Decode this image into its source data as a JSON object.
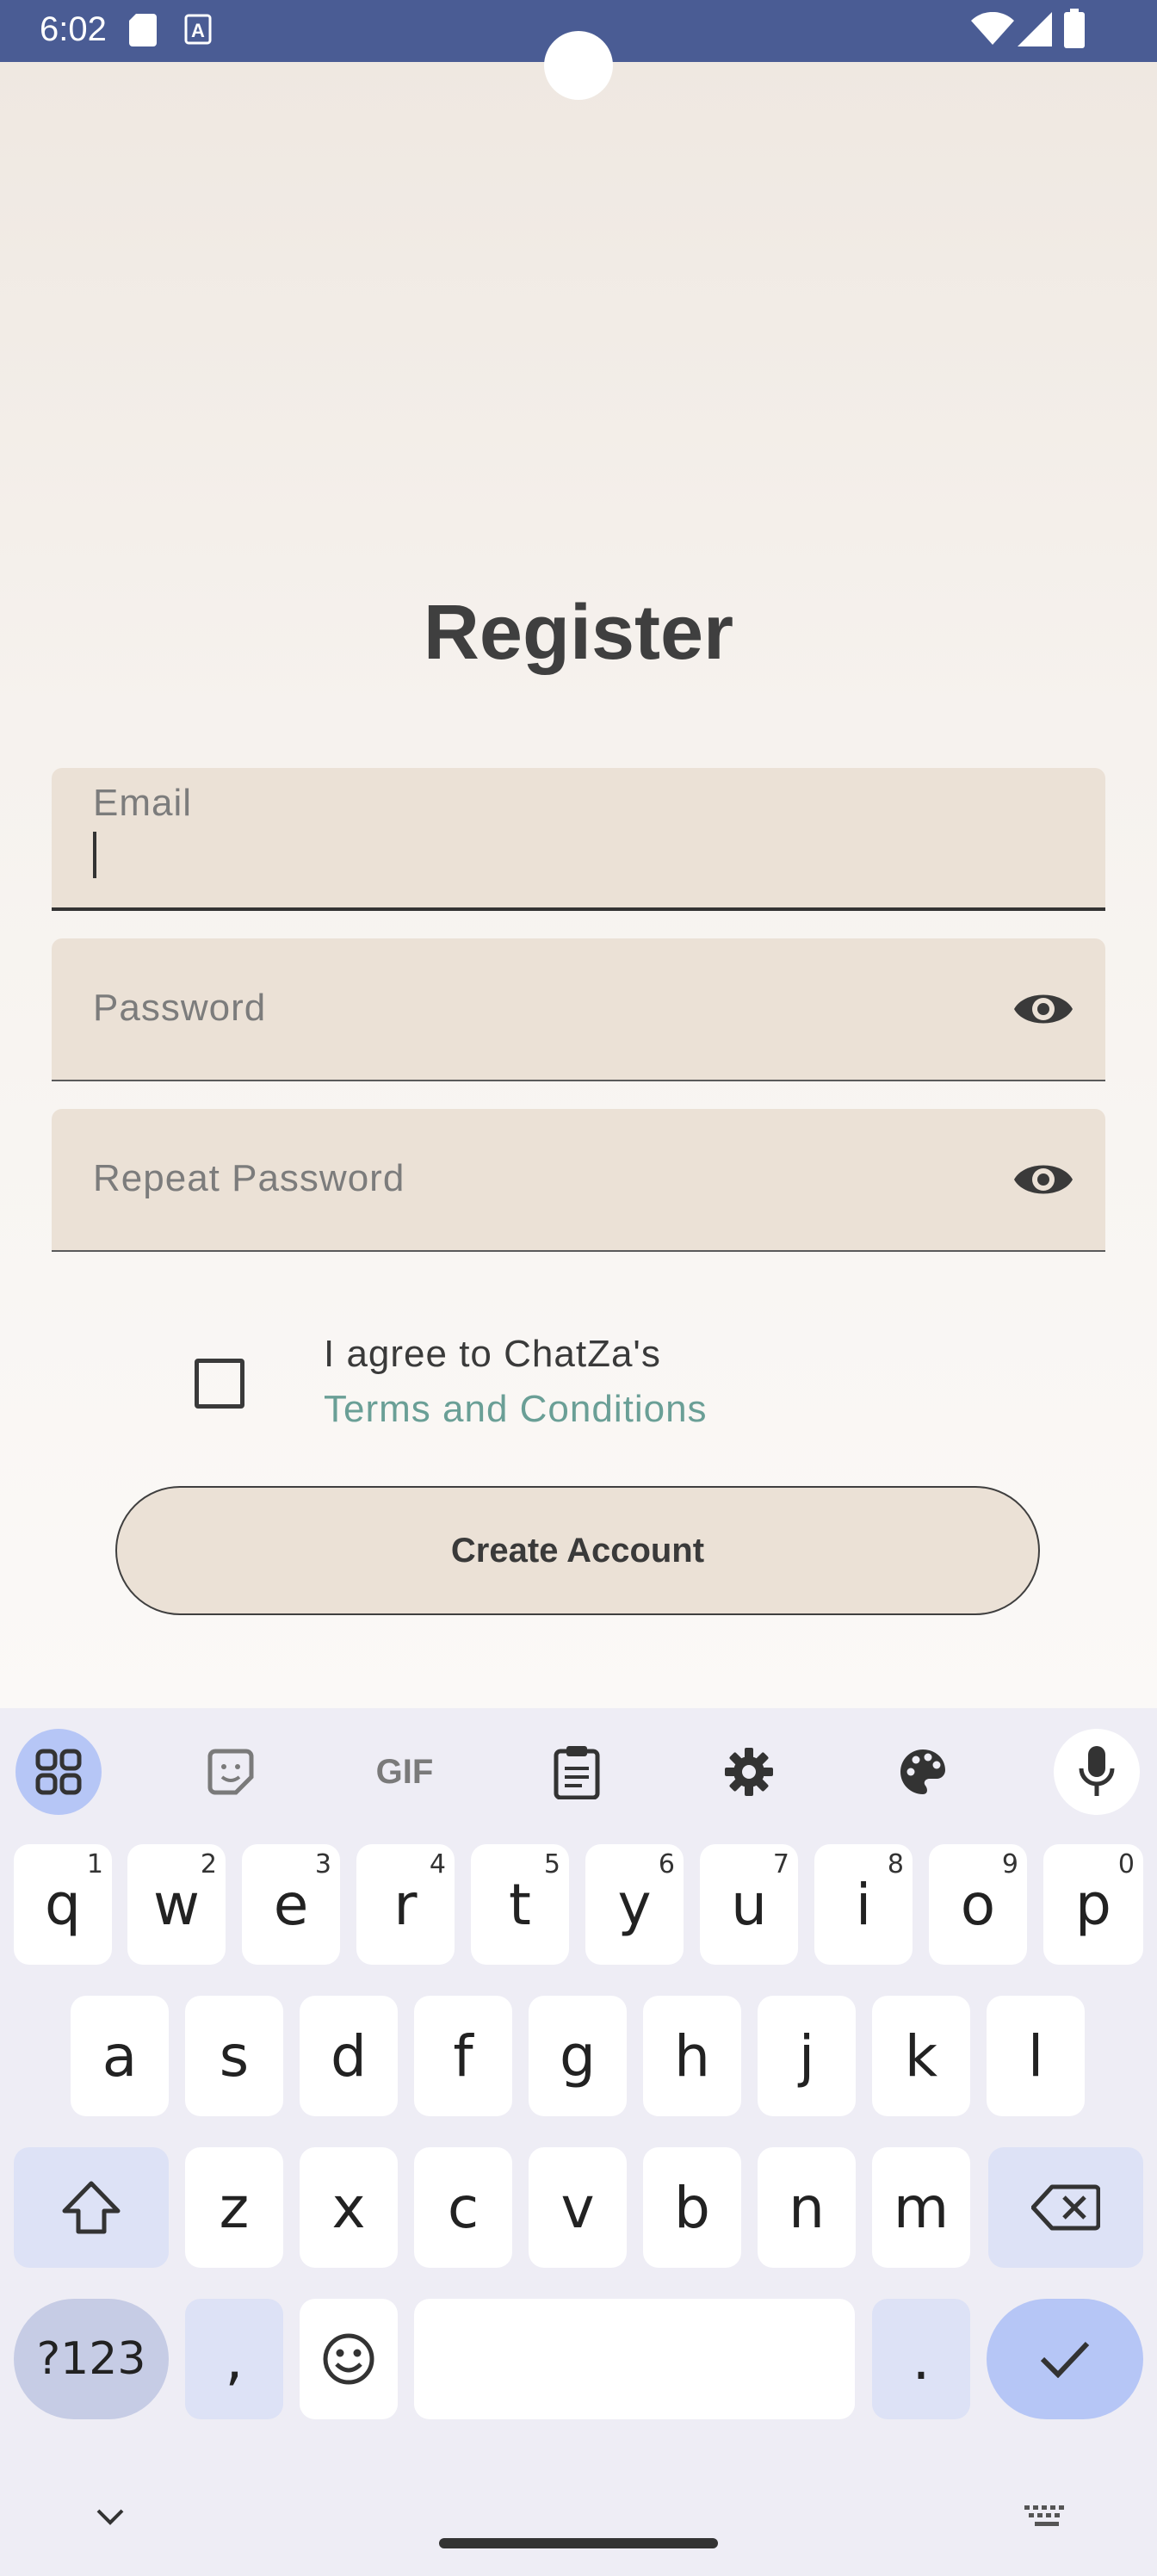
{
  "status_bar": {
    "time": "6:02",
    "icons": [
      "sd-card-icon",
      "a-badge-icon",
      "wifi-icon",
      "signal-icon",
      "battery-icon"
    ]
  },
  "form": {
    "title": "Register",
    "email_label": "Email",
    "password_placeholder": "Password",
    "repeat_password_placeholder": "Repeat Password",
    "agree_text": "I agree to ChatZa's",
    "terms_link": "Terms and Conditions",
    "create_button": "Create Account"
  },
  "colors": {
    "status_bar": "#4a5c94",
    "field_bg": "#ebe1d6",
    "link": "#6a9f96",
    "keyboard_bg": "#eeedf5",
    "key_accent": "#b6c6f6"
  },
  "keyboard": {
    "toolbar": [
      "apps-icon",
      "sticker-icon",
      "gif-icon",
      "clipboard-icon",
      "settings-icon",
      "palette-icon",
      "mic-icon"
    ],
    "gif_label": "GIF",
    "row1": [
      {
        "k": "q",
        "h": "1"
      },
      {
        "k": "w",
        "h": "2"
      },
      {
        "k": "e",
        "h": "3"
      },
      {
        "k": "r",
        "h": "4"
      },
      {
        "k": "t",
        "h": "5"
      },
      {
        "k": "y",
        "h": "6"
      },
      {
        "k": "u",
        "h": "7"
      },
      {
        "k": "i",
        "h": "8"
      },
      {
        "k": "o",
        "h": "9"
      },
      {
        "k": "p",
        "h": "0"
      }
    ],
    "row2": [
      "a",
      "s",
      "d",
      "f",
      "g",
      "h",
      "j",
      "k",
      "l"
    ],
    "row3": [
      "z",
      "x",
      "c",
      "v",
      "b",
      "n",
      "m"
    ],
    "symbols_key": "?123",
    "comma_key": ",",
    "period_key": "."
  }
}
